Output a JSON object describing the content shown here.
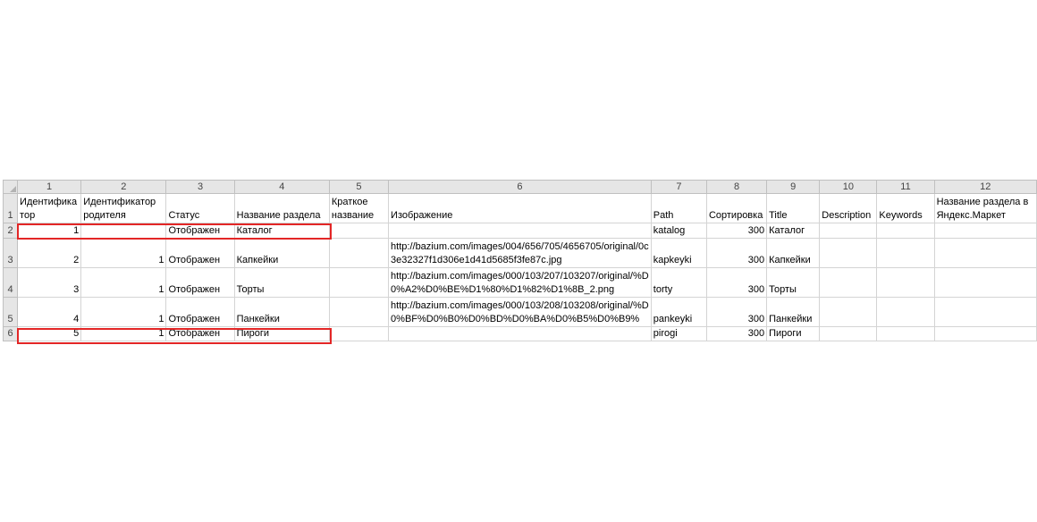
{
  "columns": [
    "1",
    "2",
    "3",
    "4",
    "5",
    "6",
    "7",
    "8",
    "9",
    "10",
    "11",
    "12"
  ],
  "rows": [
    "1",
    "2",
    "3",
    "4",
    "5",
    "6"
  ],
  "header": {
    "c1": "Идентификатор",
    "c2": "Идентификатор родителя",
    "c3": "Статус",
    "c4": "Название раздела",
    "c5": "Краткое название",
    "c6": "Изображение",
    "c7": "Path",
    "c8": "Сортировка",
    "c9": "Title",
    "c10": "Description",
    "c11": "Keywords",
    "c12": "Название раздела в Яндекс.Маркет"
  },
  "data": [
    {
      "id": "1",
      "parent": "",
      "status": "Отображен",
      "name": "Каталог",
      "short": "",
      "image": "",
      "path": "katalog",
      "sort": "300",
      "title": "Каталог"
    },
    {
      "id": "2",
      "parent": "1",
      "status": "Отображен",
      "name": "Капкейки",
      "short": "",
      "image": "http://bazium.com/images/004/656/705/4656705/original/0c3e32327f1d306e1d41d5685f3fe87c.jpg",
      "path": "kapkeyki",
      "sort": "300",
      "title": "Капкейки"
    },
    {
      "id": "3",
      "parent": "1",
      "status": "Отображен",
      "name": "Торты",
      "short": "",
      "image": "http://bazium.com/images/000/103/207/103207/original/%D0%A2%D0%BE%D1%80%D1%82%D1%8B_2.png",
      "path": "torty",
      "sort": "300",
      "title": "Торты"
    },
    {
      "id": "4",
      "parent": "1",
      "status": "Отображен",
      "name": "Панкейки",
      "short": "",
      "image": "http://bazium.com/images/000/103/208/103208/original/%D0%BF%D0%B0%D0%BD%D0%BA%D0%B5%D0%B9%",
      "path": "pankeyki",
      "sort": "300",
      "title": "Панкейки"
    },
    {
      "id": "5",
      "parent": "1",
      "status": "Отображен",
      "name": "Пироги",
      "short": "",
      "image": "",
      "path": "pirogi",
      "sort": "300",
      "title": "Пироги"
    }
  ],
  "colors": {
    "highlight": "#e32626",
    "header_bg": "#e6e6e6",
    "grid": "#d4d4d4"
  }
}
